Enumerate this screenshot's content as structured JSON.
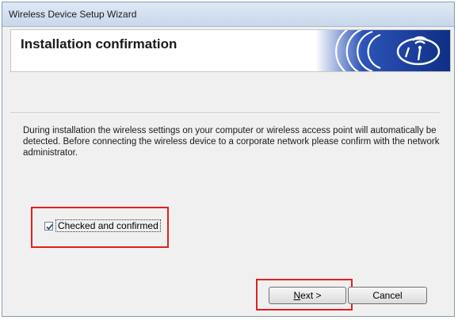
{
  "window": {
    "title": "Wireless Device Setup Wizard"
  },
  "banner": {
    "heading": "Installation confirmation",
    "icon": "wireless-signal-icon"
  },
  "body": {
    "description": "During installation the wireless settings on your computer or wireless access point will automatically be detected. Before connecting the wireless device to a corporate network please confirm with the network administrator."
  },
  "confirm": {
    "label": "Checked and confirmed",
    "checked": true
  },
  "buttons": {
    "next_mnemonic": "N",
    "next_rest": "ext >",
    "cancel": "Cancel"
  },
  "colors": {
    "highlight": "#e02020",
    "banner_blue": "#1a3f9a"
  }
}
